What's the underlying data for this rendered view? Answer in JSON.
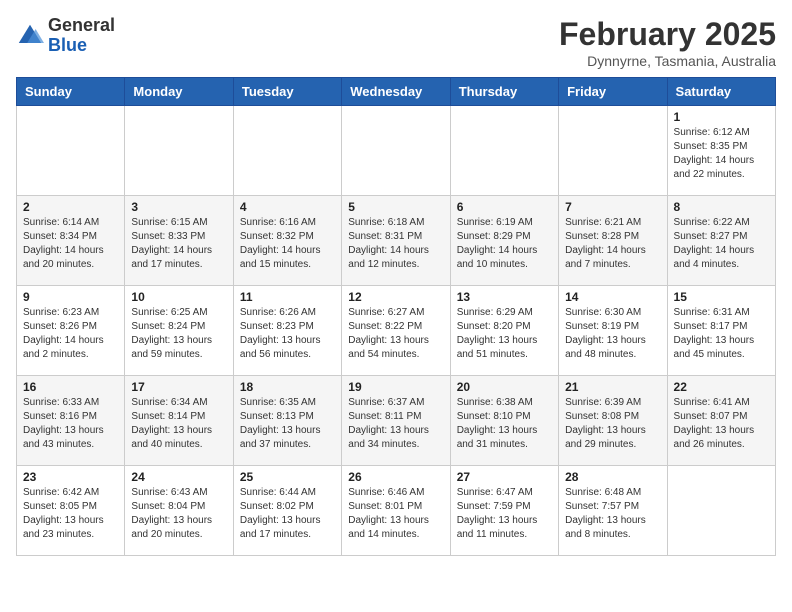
{
  "header": {
    "logo_general": "General",
    "logo_blue": "Blue",
    "month_year": "February 2025",
    "location": "Dynnyrne, Tasmania, Australia"
  },
  "weekdays": [
    "Sunday",
    "Monday",
    "Tuesday",
    "Wednesday",
    "Thursday",
    "Friday",
    "Saturday"
  ],
  "weeks": [
    [
      {
        "day": "",
        "info": ""
      },
      {
        "day": "",
        "info": ""
      },
      {
        "day": "",
        "info": ""
      },
      {
        "day": "",
        "info": ""
      },
      {
        "day": "",
        "info": ""
      },
      {
        "day": "",
        "info": ""
      },
      {
        "day": "1",
        "info": "Sunrise: 6:12 AM\nSunset: 8:35 PM\nDaylight: 14 hours\nand 22 minutes."
      }
    ],
    [
      {
        "day": "2",
        "info": "Sunrise: 6:14 AM\nSunset: 8:34 PM\nDaylight: 14 hours\nand 20 minutes."
      },
      {
        "day": "3",
        "info": "Sunrise: 6:15 AM\nSunset: 8:33 PM\nDaylight: 14 hours\nand 17 minutes."
      },
      {
        "day": "4",
        "info": "Sunrise: 6:16 AM\nSunset: 8:32 PM\nDaylight: 14 hours\nand 15 minutes."
      },
      {
        "day": "5",
        "info": "Sunrise: 6:18 AM\nSunset: 8:31 PM\nDaylight: 14 hours\nand 12 minutes."
      },
      {
        "day": "6",
        "info": "Sunrise: 6:19 AM\nSunset: 8:29 PM\nDaylight: 14 hours\nand 10 minutes."
      },
      {
        "day": "7",
        "info": "Sunrise: 6:21 AM\nSunset: 8:28 PM\nDaylight: 14 hours\nand 7 minutes."
      },
      {
        "day": "8",
        "info": "Sunrise: 6:22 AM\nSunset: 8:27 PM\nDaylight: 14 hours\nand 4 minutes."
      }
    ],
    [
      {
        "day": "9",
        "info": "Sunrise: 6:23 AM\nSunset: 8:26 PM\nDaylight: 14 hours\nand 2 minutes."
      },
      {
        "day": "10",
        "info": "Sunrise: 6:25 AM\nSunset: 8:24 PM\nDaylight: 13 hours\nand 59 minutes."
      },
      {
        "day": "11",
        "info": "Sunrise: 6:26 AM\nSunset: 8:23 PM\nDaylight: 13 hours\nand 56 minutes."
      },
      {
        "day": "12",
        "info": "Sunrise: 6:27 AM\nSunset: 8:22 PM\nDaylight: 13 hours\nand 54 minutes."
      },
      {
        "day": "13",
        "info": "Sunrise: 6:29 AM\nSunset: 8:20 PM\nDaylight: 13 hours\nand 51 minutes."
      },
      {
        "day": "14",
        "info": "Sunrise: 6:30 AM\nSunset: 8:19 PM\nDaylight: 13 hours\nand 48 minutes."
      },
      {
        "day": "15",
        "info": "Sunrise: 6:31 AM\nSunset: 8:17 PM\nDaylight: 13 hours\nand 45 minutes."
      }
    ],
    [
      {
        "day": "16",
        "info": "Sunrise: 6:33 AM\nSunset: 8:16 PM\nDaylight: 13 hours\nand 43 minutes."
      },
      {
        "day": "17",
        "info": "Sunrise: 6:34 AM\nSunset: 8:14 PM\nDaylight: 13 hours\nand 40 minutes."
      },
      {
        "day": "18",
        "info": "Sunrise: 6:35 AM\nSunset: 8:13 PM\nDaylight: 13 hours\nand 37 minutes."
      },
      {
        "day": "19",
        "info": "Sunrise: 6:37 AM\nSunset: 8:11 PM\nDaylight: 13 hours\nand 34 minutes."
      },
      {
        "day": "20",
        "info": "Sunrise: 6:38 AM\nSunset: 8:10 PM\nDaylight: 13 hours\nand 31 minutes."
      },
      {
        "day": "21",
        "info": "Sunrise: 6:39 AM\nSunset: 8:08 PM\nDaylight: 13 hours\nand 29 minutes."
      },
      {
        "day": "22",
        "info": "Sunrise: 6:41 AM\nSunset: 8:07 PM\nDaylight: 13 hours\nand 26 minutes."
      }
    ],
    [
      {
        "day": "23",
        "info": "Sunrise: 6:42 AM\nSunset: 8:05 PM\nDaylight: 13 hours\nand 23 minutes."
      },
      {
        "day": "24",
        "info": "Sunrise: 6:43 AM\nSunset: 8:04 PM\nDaylight: 13 hours\nand 20 minutes."
      },
      {
        "day": "25",
        "info": "Sunrise: 6:44 AM\nSunset: 8:02 PM\nDaylight: 13 hours\nand 17 minutes."
      },
      {
        "day": "26",
        "info": "Sunrise: 6:46 AM\nSunset: 8:01 PM\nDaylight: 13 hours\nand 14 minutes."
      },
      {
        "day": "27",
        "info": "Sunrise: 6:47 AM\nSunset: 7:59 PM\nDaylight: 13 hours\nand 11 minutes."
      },
      {
        "day": "28",
        "info": "Sunrise: 6:48 AM\nSunset: 7:57 PM\nDaylight: 13 hours\nand 8 minutes."
      },
      {
        "day": "",
        "info": ""
      }
    ]
  ]
}
